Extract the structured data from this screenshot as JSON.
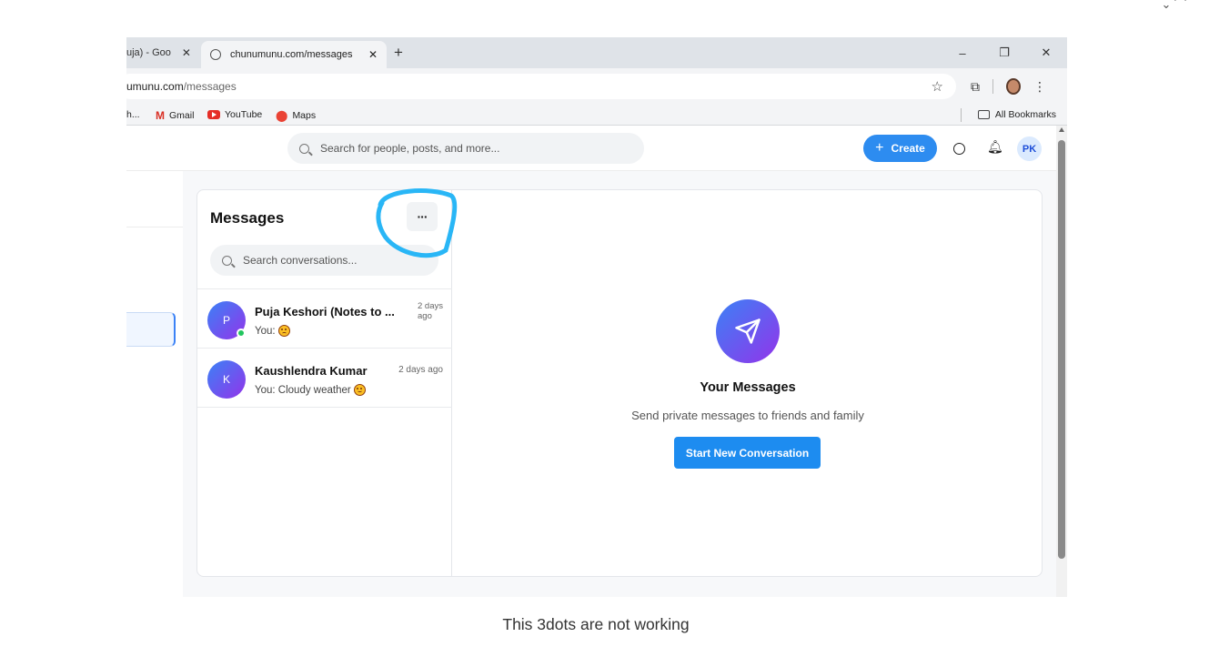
{
  "browser": {
    "prev_tab_label": "uja) - Goo",
    "active_tab_label": "chunumunu.com/messages",
    "new_tab_symbol": "+",
    "window_controls": [
      "–",
      "❐",
      "✕"
    ],
    "url_host": "umunu.com",
    "url_path": "/messages",
    "bookmarks": [
      {
        "label": "h...",
        "icon": "none"
      },
      {
        "label": "Gmail",
        "icon": "gmail-icon"
      },
      {
        "label": "YouTube",
        "icon": "youtube-icon"
      },
      {
        "label": "Maps",
        "icon": "maps-icon"
      }
    ],
    "all_bookmarks_label": "All Bookmarks"
  },
  "topnav": {
    "search_placeholder": "Search for people, posts, and more...",
    "create_label": "Create",
    "avatar_initials": "PK",
    "accent_color": "#2d8cf0"
  },
  "messages": {
    "title": "Messages",
    "more_label": "···",
    "search_placeholder": "Search conversations...",
    "conversations": [
      {
        "initial": "P",
        "name": "Puja Keshori (Notes to ...",
        "time_line1": "2 days",
        "time_line2": "ago",
        "preview": "You:",
        "emoji": "sad-face-emoji",
        "online": true
      },
      {
        "initial": "K",
        "name": "Kaushlendra Kumar",
        "time": "2 days ago",
        "preview": "You: Cloudy weather",
        "emoji": "smile-face-emoji",
        "online": false
      }
    ]
  },
  "empty_state": {
    "icon": "send-icon",
    "title": "Your Messages",
    "subtitle": "Send private messages to friends and family",
    "button_label": "Start New Conversation"
  },
  "annotation": {
    "caption": "This 3dots are not working",
    "circle_color": "#29b6f6"
  }
}
